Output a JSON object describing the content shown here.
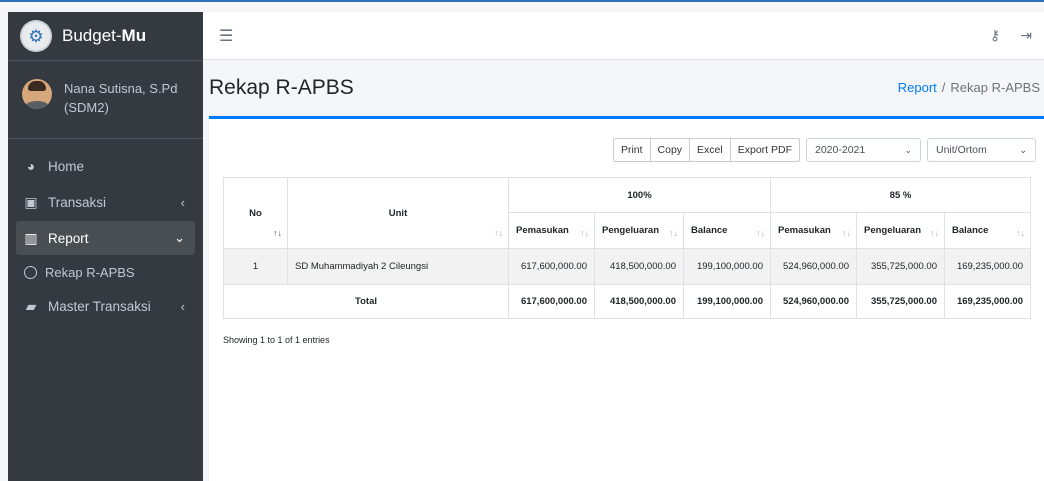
{
  "brand": {
    "prefix": "Budget-",
    "suffix": "Mu",
    "logo_icon": "gear-logo-icon"
  },
  "user": {
    "name_line1": "Nana Sutisna, S.Pd",
    "name_line2": "(SDM2)"
  },
  "sidebar": {
    "items": [
      {
        "label": "Home",
        "icon": "dashboard-icon"
      },
      {
        "label": "Transaksi",
        "icon": "calendar-check-icon"
      },
      {
        "label": "Report",
        "icon": "chart-icon"
      },
      {
        "label": "Rekap R-APBS",
        "icon": "circle-icon"
      },
      {
        "label": "Master Transaksi",
        "icon": "folder-open-icon"
      }
    ]
  },
  "topbar": {
    "menu_icon": "hamburger-icon",
    "key_icon": "key-icon",
    "logout_icon": "sign-out-icon"
  },
  "page": {
    "title": "Rekap R-APBS"
  },
  "breadcrumb": {
    "link": "Report",
    "separator": "/",
    "current": "Rekap R-APBS"
  },
  "toolbar": {
    "print": "Print",
    "copy": "Copy",
    "excel": "Excel",
    "pdf": "Export PDF",
    "year_select": "2020-2021",
    "unit_select": "Unit/Ortom"
  },
  "table": {
    "headers": {
      "no": "No",
      "unit": "Unit",
      "group1": "100%",
      "group2": "85 %"
    },
    "subheaders": [
      "Pemasukan",
      "Pengeluaran",
      "Balance",
      "Pemasukan",
      "Pengeluaran",
      "Balance"
    ],
    "rows": [
      {
        "no": "1",
        "unit": "SD Muhammadiyah 2 Cileungsi",
        "values": [
          "617,600,000.00",
          "418,500,000.00",
          "199,100,000.00",
          "524,960,000.00",
          "355,725,000.00",
          "169,235,000.00"
        ]
      }
    ],
    "total": {
      "label": "Total",
      "values": [
        "617,600,000.00",
        "418,500,000.00",
        "199,100,000.00",
        "524,960,000.00",
        "355,725,000.00",
        "169,235,000.00"
      ]
    }
  },
  "info": "Showing 1 to 1 of 1 entries",
  "colors": {
    "sidebar_bg": "#343a40",
    "primary": "#007bff",
    "active_item": "#494e53"
  }
}
